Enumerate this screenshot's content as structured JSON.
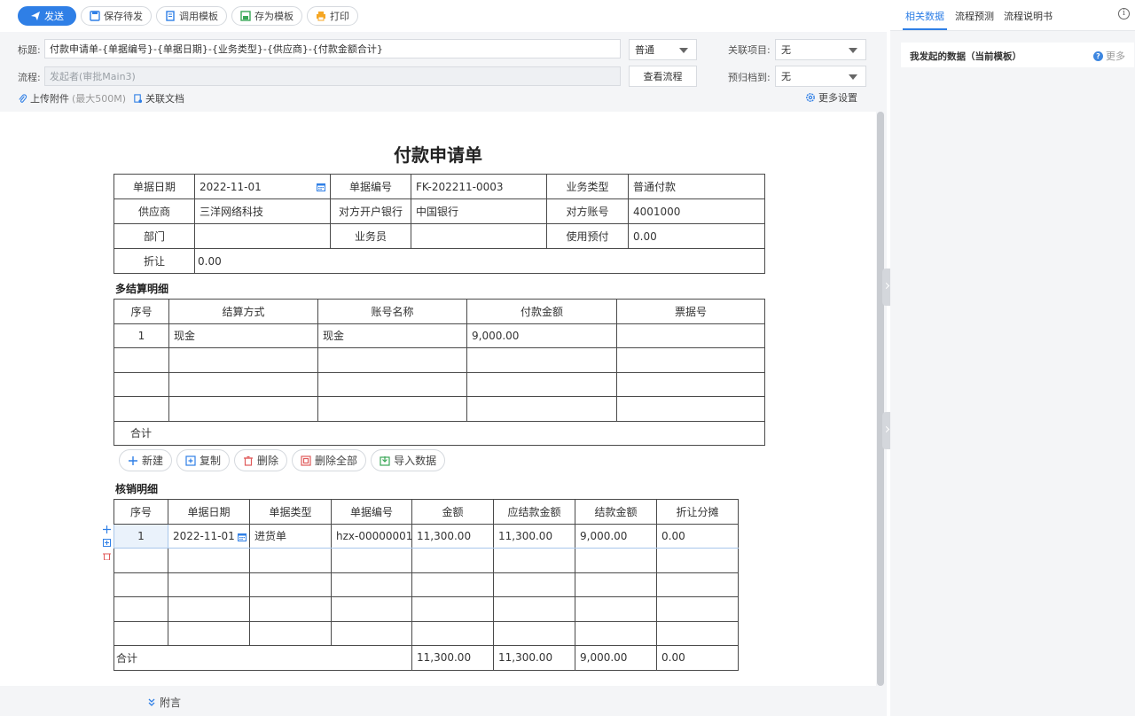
{
  "toolbar": {
    "send": "发送",
    "save_draft": "保存待发",
    "use_template": "调用模板",
    "save_template": "存为模板",
    "print": "打印"
  },
  "header": {
    "title_label": "标题:",
    "title_value": "付款申请单-{单据编号}-{单据日期}-{业务类型}-{供应商}-{付款金额合计}",
    "priority_value": "普通",
    "related_project_label": "关联项目:",
    "related_project_value": "无",
    "flow_label": "流程:",
    "flow_placeholder": "发起者(审批Main3)",
    "view_flow": "查看流程",
    "archive_label": "预归档到:",
    "archive_value": "无",
    "upload": "上传附件",
    "upload_limit": "(最大500M)",
    "related_docs": "关联文档",
    "more_settings": "更多设置"
  },
  "form": {
    "title": "付款申请单",
    "main": {
      "date_label": "单据日期",
      "date_value": "2022-11-01",
      "no_label": "单据编号",
      "no_value": "FK-202211-0003",
      "biz_type_label": "业务类型",
      "biz_type_value": "普通付款",
      "supplier_label": "供应商",
      "supplier_value": "三洋网络科技",
      "bank_label": "对方开户银行",
      "bank_value": "中国银行",
      "account_label": "对方账号",
      "account_value": "4001000",
      "dept_label": "部门",
      "dept_value": "",
      "staff_label": "业务员",
      "staff_value": "",
      "prepay_label": "使用预付",
      "prepay_value": "0.00",
      "discount_label": "折让",
      "discount_value": "0.00"
    },
    "settle": {
      "title": "多结算明细",
      "headers": [
        "序号",
        "结算方式",
        "账号名称",
        "付款金额",
        "票据号"
      ],
      "rows": [
        [
          "1",
          "现金",
          "现金",
          "9,000.00",
          ""
        ],
        [
          "",
          "",
          "",
          "",
          ""
        ],
        [
          "",
          "",
          "",
          "",
          ""
        ],
        [
          "",
          "",
          "",
          "",
          ""
        ]
      ],
      "total_label": "合计"
    },
    "row_buttons": {
      "new": "新建",
      "copy": "复制",
      "delete": "删除",
      "delete_all": "删除全部",
      "import": "导入数据"
    },
    "verify": {
      "title": "核销明细",
      "headers": [
        "序号",
        "单据日期",
        "单据类型",
        "单据编号",
        "金额",
        "应结款金额",
        "结款金额",
        "折让分摊"
      ],
      "rows": [
        [
          "1",
          "2022-11-01",
          "进货单",
          "hzx-00000001",
          "11,300.00",
          "11,300.00",
          "9,000.00",
          "0.00"
        ],
        [
          "",
          "",
          "",
          "",
          "",
          "",
          "",
          ""
        ],
        [
          "",
          "",
          "",
          "",
          "",
          "",
          "",
          ""
        ],
        [
          "",
          "",
          "",
          "",
          "",
          "",
          "",
          ""
        ],
        [
          "",
          "",
          "",
          "",
          "",
          "",
          "",
          ""
        ]
      ],
      "total_label": "合计",
      "total_amount": "11,300.00",
      "total_payable": "11,300.00",
      "total_paid": "9,000.00",
      "total_discount": "0.00"
    },
    "note": "附言"
  },
  "right_panel": {
    "tabs": [
      "相关数据",
      "流程预测",
      "流程说明书"
    ],
    "card_title": "我发起的数据（当前模板）",
    "more": "更多"
  },
  "colors": {
    "primary": "#2f7fe6",
    "delete_red": "#e05a5a",
    "print_orange": "#f5a623",
    "template_green": "#3aa757"
  }
}
